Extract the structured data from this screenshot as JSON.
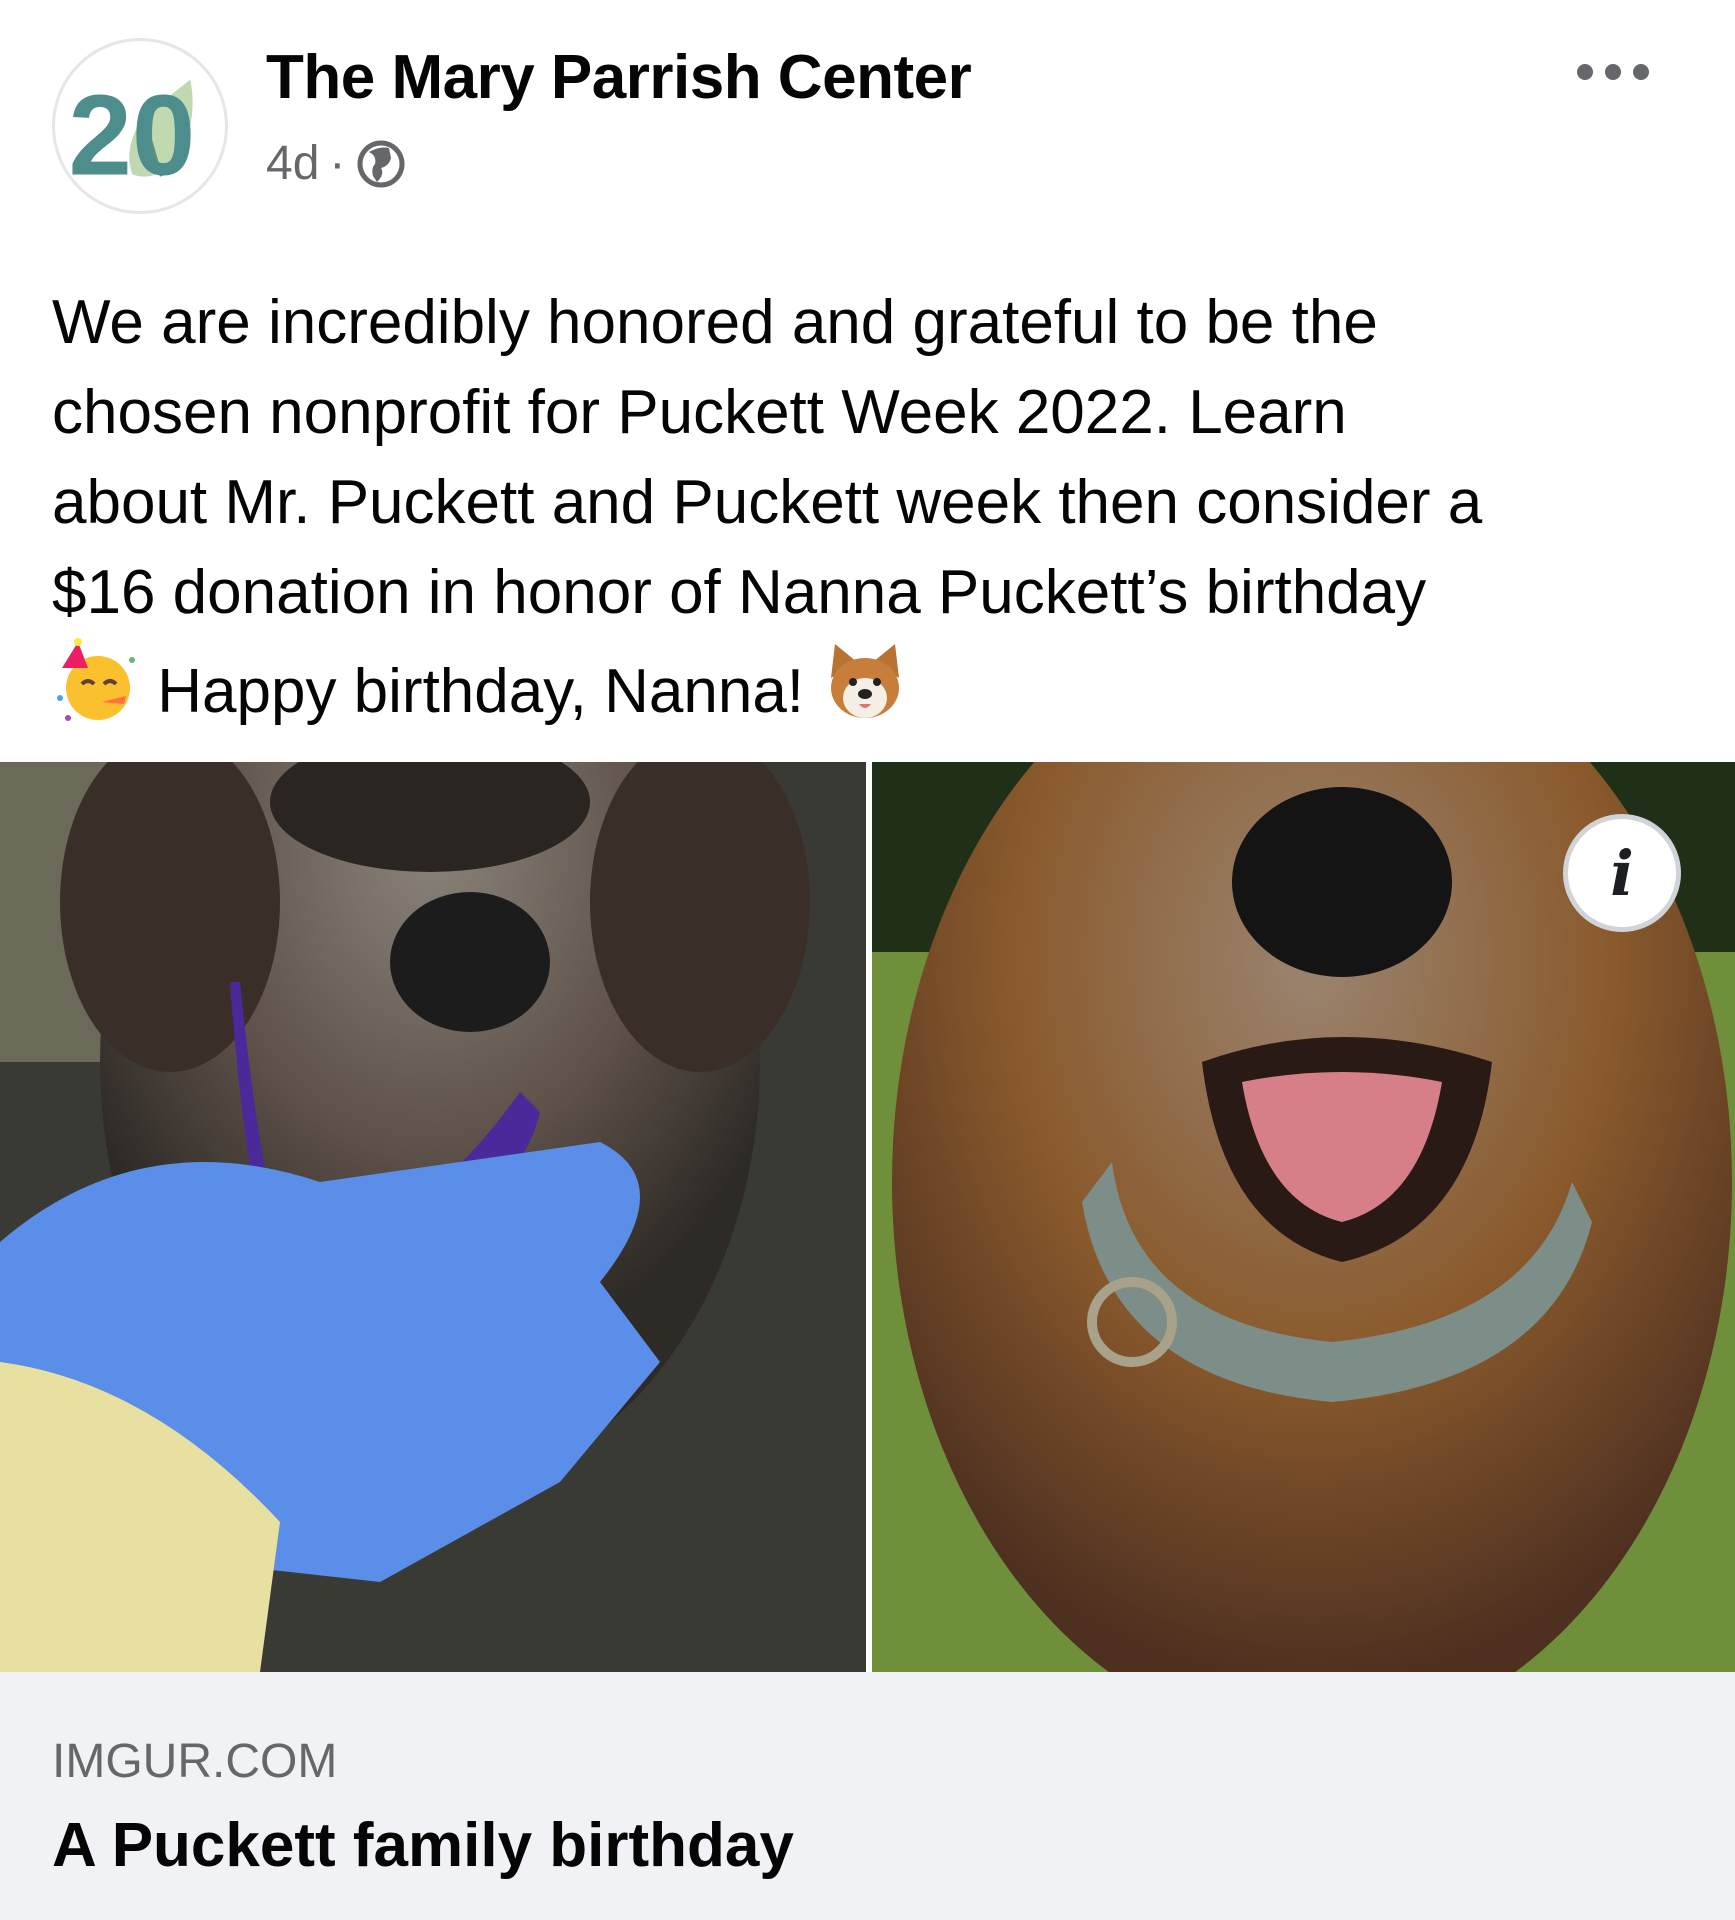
{
  "post": {
    "page_name": "The Mary Parrish Center",
    "timestamp": "4d",
    "separator": "·",
    "avatar_text": "20",
    "text_line1": "We are incredibly honored and grateful to be the",
    "text_line2": "chosen nonprofit for Puckett Week 2022. Learn",
    "text_line3": "about Mr. Puckett and Puckett week then consider a",
    "text_line4": "$16 donation in honor of Nanna Puckett’s birthday",
    "text_line5": "Happy birthday, Nanna!"
  },
  "icons": {
    "audience": "globe-icon",
    "more": "more-options-icon",
    "emoji1": "partying-face-emoji",
    "emoji2": "dog-face-emoji",
    "info": "info-icon"
  },
  "link_preview": {
    "domain": "IMGUR.COM",
    "title": "A Puckett family birthday",
    "info_label": "i"
  },
  "colors": {
    "avatar_teal": "#4d8d8c",
    "meta_gray": "#65676b",
    "preview_bg": "#f0f2f5"
  }
}
